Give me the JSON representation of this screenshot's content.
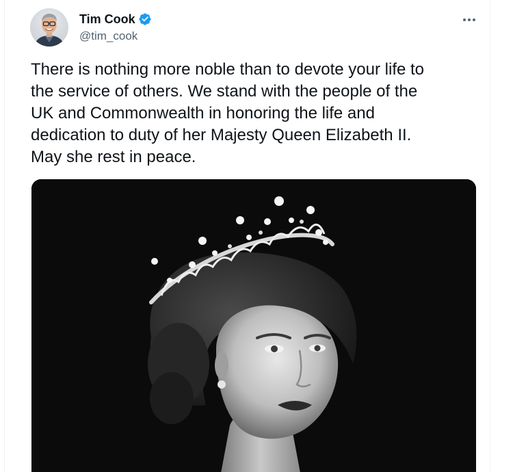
{
  "tweet": {
    "author": {
      "name": "Tim Cook",
      "handle": "@tim_cook",
      "verified": true,
      "avatar_icon": "profile-photo"
    },
    "more_icon": "more-horizontal-icon",
    "text_lines": [
      "There is nothing more noble than to devote your life to",
      "the service of others. We stand with the people of the",
      "UK and Commonwealth in honoring the life and",
      "dedication to duty of her Majesty Queen Elizabeth II.",
      "May she rest in peace."
    ],
    "media": {
      "type": "photo",
      "style": "black-and-white portrait"
    }
  },
  "colors": {
    "text_primary": "#0f1419",
    "text_secondary": "#536471",
    "verified_blue": "#1d9bf0",
    "border": "#eff3f4",
    "photo_background": "#0b0b0b"
  }
}
